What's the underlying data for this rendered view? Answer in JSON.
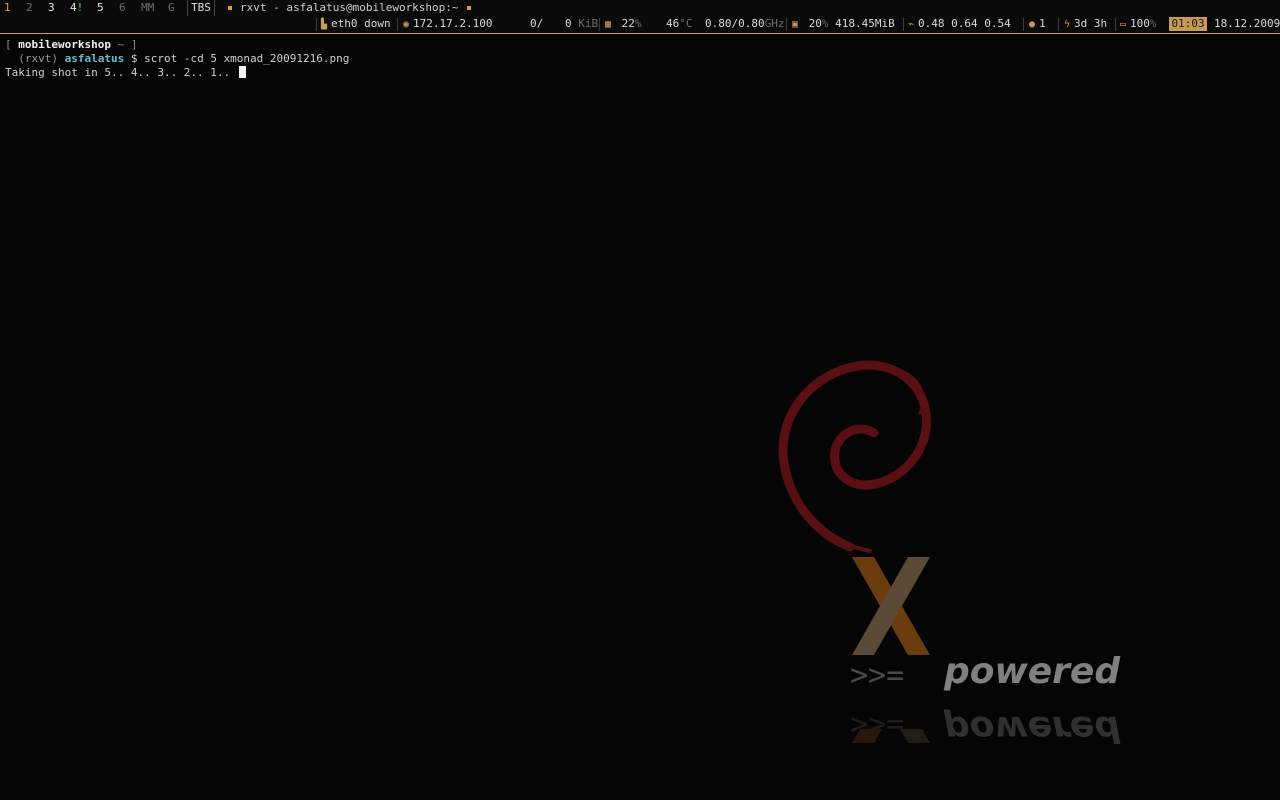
{
  "workspaces": [
    {
      "label": "1",
      "state": "current"
    },
    {
      "label": "2",
      "state": "empty"
    },
    {
      "label": "3",
      "state": "occupied"
    },
    {
      "label": "4",
      "state": "occupied",
      "urgent_mark": "!"
    },
    {
      "label": "5",
      "state": "occupied"
    },
    {
      "label": "6",
      "state": "empty"
    },
    {
      "label": "MM",
      "state": "empty"
    },
    {
      "label": "G",
      "state": "empty"
    }
  ],
  "layout": "TBS",
  "window_title": "rxvt - asfalatus@mobileworkshop:~",
  "status": {
    "net_if": "eth0 down",
    "wifi_ip": "172.17.2.100",
    "net_rx": "0/",
    "net_tx": "0",
    "net_unit": "KiB",
    "cpu_load": "22",
    "percent_unit": "%",
    "cpu_temp": "46",
    "temp_unit": "°C",
    "cpu_freq": "0.80/0.80",
    "freq_unit": "GHz",
    "mem_pct": "20",
    "mem_used": "418.45MiB",
    "load1": "0.48",
    "load5": "0.64",
    "load15": "0.54",
    "users": "1",
    "uptime": "3d 3h",
    "battery": "100",
    "time": "01:03",
    "date": "18.12.2009"
  },
  "terminal": {
    "prompt_open": "[ ",
    "host": "mobileworkshop",
    "prompt_path": " ~ ]",
    "shell": "  (rxvt) ",
    "user": "asfalatus",
    "dollar": " $ ",
    "command": "scrot -cd 5 xmonad_20091216.png",
    "output": "Taking shot in 5.. 4.. 3.. 2.. 1.. "
  },
  "wallpaper": {
    "x_letter": "X",
    "operator": ">>=",
    "powered_text": "powered"
  },
  "colors": {
    "accent": "#c99a52",
    "user": "#5fc0c8",
    "swirl": "#5a0f12"
  }
}
